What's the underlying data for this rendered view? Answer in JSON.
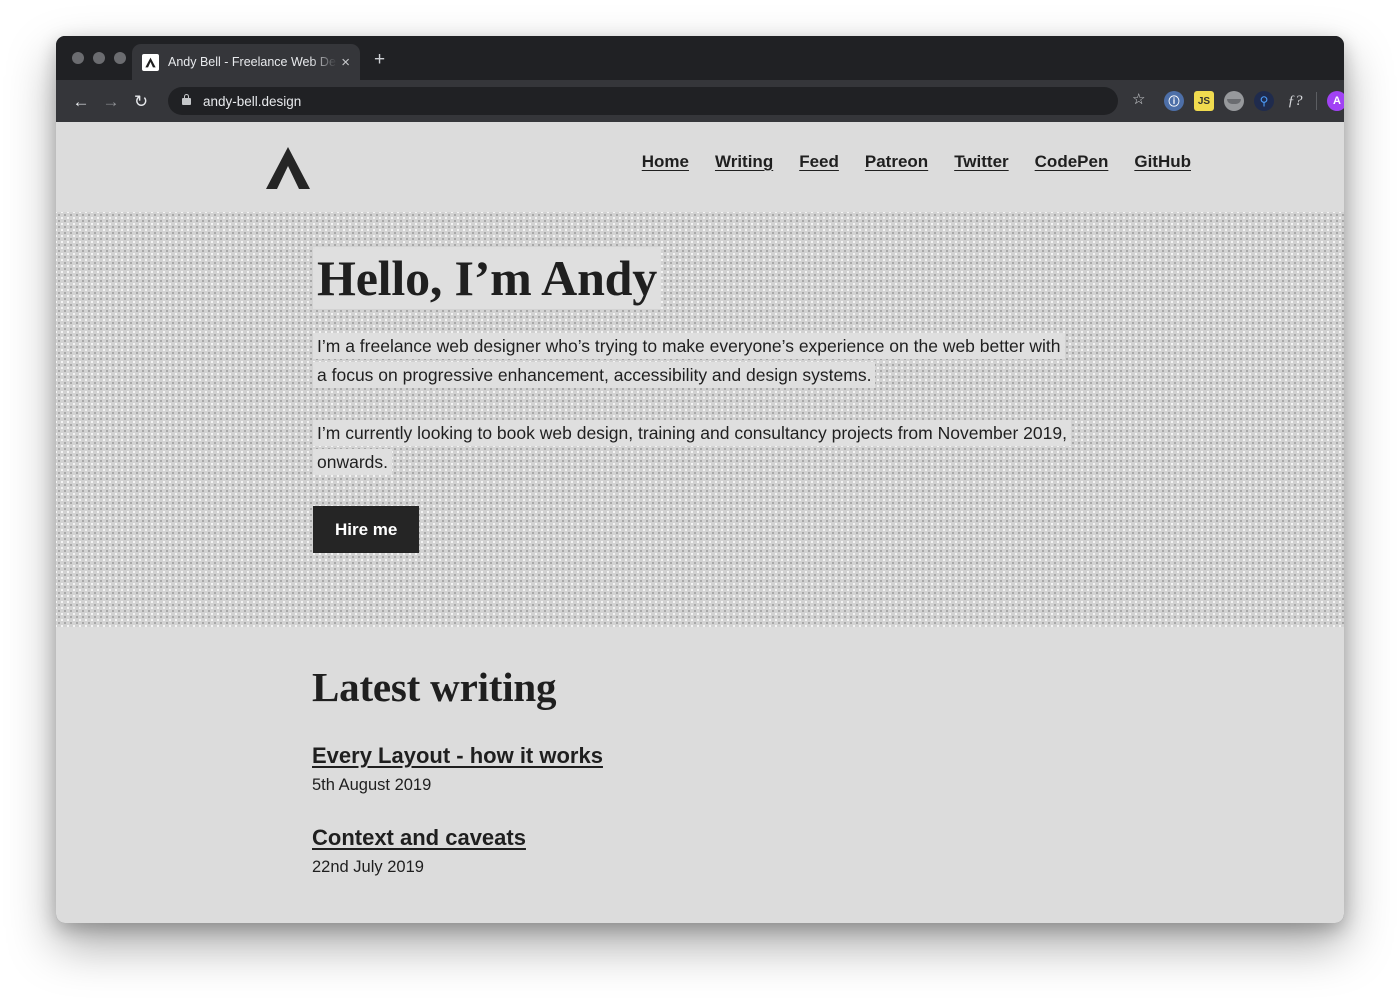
{
  "browser": {
    "tab": {
      "title": "Andy Bell - Freelance Web Des",
      "favicon_name": "andy-bell-logo",
      "close_label": "×"
    },
    "new_tab_label": "+",
    "back_label": "←",
    "forward_label": "→",
    "reload_label": "↻",
    "url": "andy-bell.design",
    "bookmark_star": "☆",
    "extensions": [
      {
        "name": "wappalyzer-extension-icon",
        "glyph": "ⓘ"
      },
      {
        "name": "javascript-toggle-extension-icon",
        "glyph": "JS"
      },
      {
        "name": "grayscale-extension-icon",
        "glyph": ""
      },
      {
        "name": "search-extension-icon",
        "glyph": "⚲"
      },
      {
        "name": "function-extension-icon",
        "glyph": "ƒ?"
      }
    ],
    "profile_initial": "A",
    "menu_label": "⋮"
  },
  "site": {
    "logo_name": "andy-bell-chevron-logo",
    "nav": [
      {
        "label": "Home"
      },
      {
        "label": "Writing"
      },
      {
        "label": "Feed"
      },
      {
        "label": "Patreon"
      },
      {
        "label": "Twitter"
      },
      {
        "label": "CodePen"
      },
      {
        "label": "GitHub"
      }
    ],
    "hero": {
      "heading": "Hello, I’m Andy",
      "paragraph_1": "I’m a freelance web designer who’s trying to make everyone’s experience on the web better with a focus on progressive enhancement, accessibility and design systems.",
      "paragraph_2": "I’m currently looking to book web design, training and consultancy projects from November 2019, onwards.",
      "cta_label": "Hire me"
    },
    "writing": {
      "heading": "Latest writing",
      "posts": [
        {
          "title": "Every Layout - how it works",
          "date": "5th August 2019"
        },
        {
          "title": "Context and caveats",
          "date": "22nd July 2019"
        }
      ]
    }
  },
  "colors": {
    "page_bg": "#dcdcdc",
    "hero_bg": "#d2d2d2",
    "ink": "#1f1f1f",
    "cta_bg": "#252525",
    "chrome_tabstrip": "#202124",
    "chrome_toolbar": "#35363a",
    "avatar": "#a142f4"
  }
}
